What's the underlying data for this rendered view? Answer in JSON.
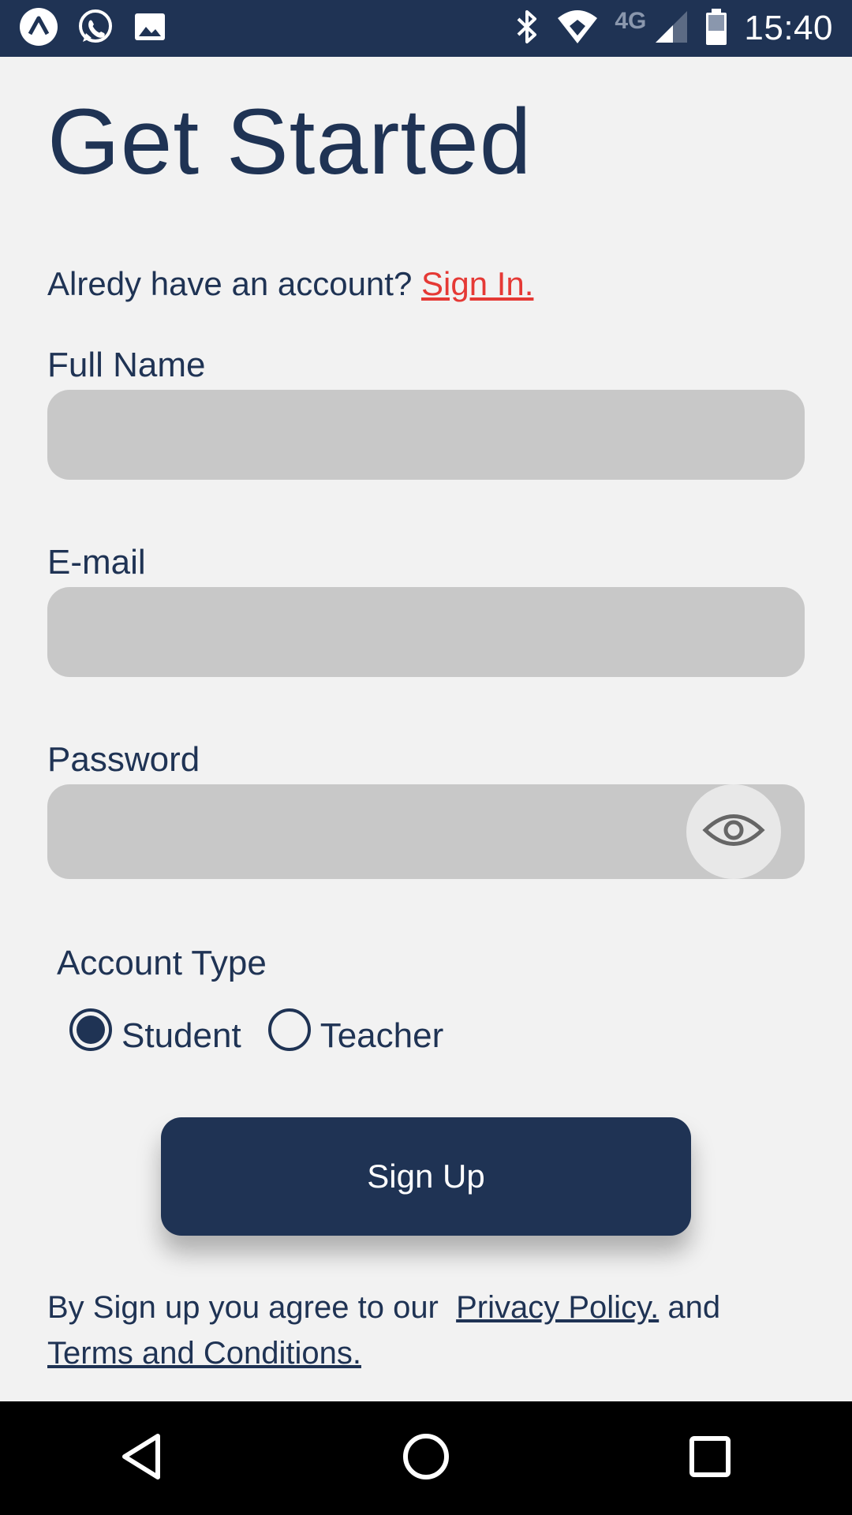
{
  "status_bar": {
    "left_icons": [
      "app-launcher-icon",
      "whatsapp-icon",
      "gallery-icon"
    ],
    "right_icons": [
      "bluetooth-icon",
      "wifi-icon",
      "cellular-signal-icon",
      "battery-icon"
    ],
    "network_label": "4G",
    "time": "15:40"
  },
  "header": {
    "title": "Get Started"
  },
  "signin": {
    "prompt": "Alredy have an account?",
    "link": "Sign In."
  },
  "form": {
    "full_name": {
      "label": "Full Name",
      "value": "",
      "placeholder": ""
    },
    "email": {
      "label": "E-mail",
      "value": "",
      "placeholder": ""
    },
    "password": {
      "label": "Password",
      "value": "",
      "placeholder": "",
      "toggle_icon": "eye-icon"
    },
    "account_type": {
      "label": "Account Type",
      "options": [
        {
          "label": "Student",
          "selected": true
        },
        {
          "label": "Teacher",
          "selected": false
        }
      ]
    },
    "submit_label": "Sign Up"
  },
  "agreement": {
    "prefix": "By Sign up you agree to our",
    "privacy_link": "Privacy Policy.",
    "conjunction": "and",
    "terms_link": "Terms and Conditions."
  },
  "nav_bar": {
    "buttons": [
      "back-icon",
      "home-icon",
      "recents-icon"
    ]
  },
  "colors": {
    "primary": "#1f3354",
    "background": "#f2f2f2",
    "input_fill": "#c8c8c8",
    "link_red": "#e53935"
  }
}
